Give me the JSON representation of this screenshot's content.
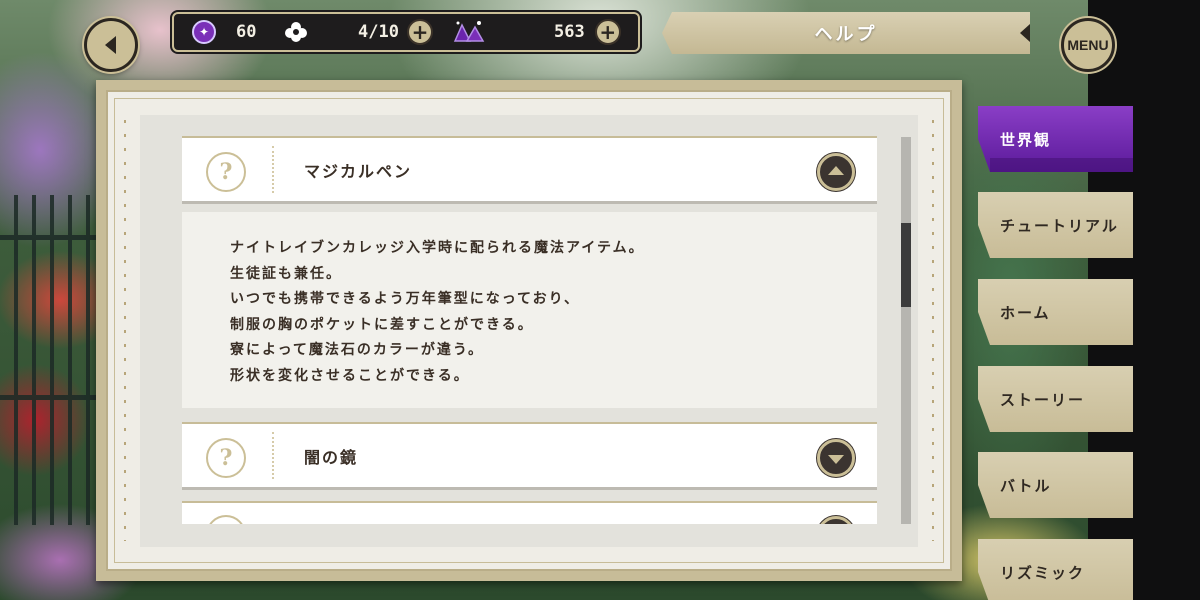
{
  "hud": {
    "gem_count": "60",
    "stamina": "4/10",
    "madol": "563"
  },
  "header": {
    "title": "ヘルプ",
    "menu_label": "MENU"
  },
  "accordion": [
    {
      "title": "マジカルペン",
      "expanded": true,
      "body_lines": [
        "ナイトレイブンカレッジ入学時に配られる魔法アイテム。",
        "生徒証も兼任。",
        "いつでも携帯できるよう万年筆型になっており、",
        "制服の胸のポケットに差すことができる。",
        "寮によって魔法石のカラーが違う。",
        "形状を変化させることができる。"
      ]
    },
    {
      "title": "闇の鏡",
      "expanded": false
    }
  ],
  "tabs": [
    {
      "label": "世界観",
      "active": true
    },
    {
      "label": "チュートリアル",
      "active": false
    },
    {
      "label": "ホーム",
      "active": false
    },
    {
      "label": "ストーリー",
      "active": false
    },
    {
      "label": "バトル",
      "active": false
    },
    {
      "label": "リズミック",
      "active": false
    }
  ],
  "colors": {
    "accent_purple": "#6b24ad",
    "gold": "#cbbf97",
    "dark": "#2b2620"
  }
}
